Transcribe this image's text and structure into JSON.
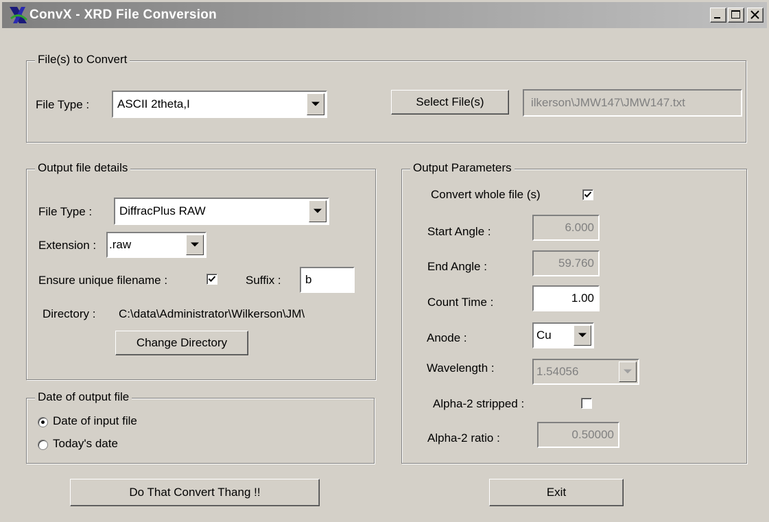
{
  "window": {
    "title": "ConvX - XRD File Conversion",
    "titlebar_colors": [
      "#808080",
      "#c0c0c0"
    ]
  },
  "files_group": {
    "legend": "File(s) to Convert",
    "file_type_label": "File Type :",
    "file_type_value": "ASCII 2theta,I",
    "select_button": "Select File(s)",
    "selected_path": "ilkerson\\JMW147\\JMW147.txt"
  },
  "output_group": {
    "legend": "Output file details",
    "file_type_label": "File Type :",
    "file_type_value": "DiffracPlus RAW",
    "extension_label": "Extension :",
    "extension_value": ".raw",
    "unique_label": "Ensure unique filename :",
    "unique_checked": true,
    "suffix_label": "Suffix :",
    "suffix_value": "b",
    "directory_label": "Directory :",
    "directory_value": "C:\\data\\Administrator\\Wilkerson\\JM\\",
    "change_dir_button": "Change Directory"
  },
  "date_group": {
    "legend": "Date of output file",
    "options": [
      {
        "label": "Date of input file",
        "selected": true
      },
      {
        "label": "Today's date",
        "selected": false
      }
    ]
  },
  "params_group": {
    "legend": "Output Parameters",
    "convert_whole_label": "Convert whole file (s)",
    "convert_whole_checked": true,
    "start_angle_label": "Start Angle :",
    "start_angle_value": "6.000",
    "end_angle_label": "End Angle :",
    "end_angle_value": "59.760",
    "count_time_label": "Count  Time :",
    "count_time_value": "1.00",
    "anode_label": "Anode :",
    "anode_value": "Cu",
    "wavelength_label": "Wavelength :",
    "wavelength_value": "1.54056",
    "alpha2_stripped_label": "Alpha-2 stripped :",
    "alpha2_stripped_checked": false,
    "alpha2_ratio_label": "Alpha-2 ratio :",
    "alpha2_ratio_value": "0.50000"
  },
  "actions": {
    "convert_button": "Do That Convert Thang !!",
    "exit_button": "Exit"
  }
}
